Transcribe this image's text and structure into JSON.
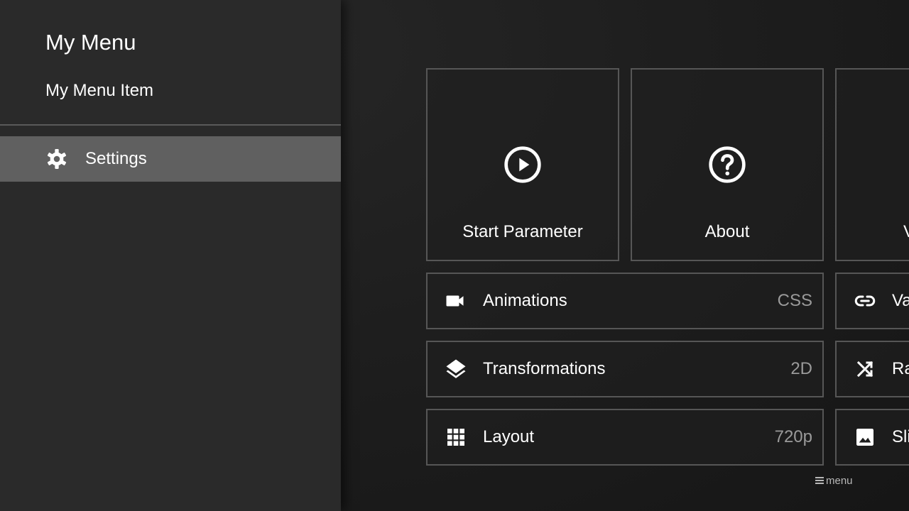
{
  "sidebar": {
    "title": "My Menu",
    "item_label": "My Menu Item",
    "settings_label": "Settings",
    "settings_icon": "gear-icon"
  },
  "tiles": {
    "start": {
      "label": "Start Parameter",
      "icon": "play-circle-icon"
    },
    "about": {
      "label": "About",
      "icon": "help-circle-icon"
    },
    "partial_top": {
      "label": "V"
    }
  },
  "rows": {
    "animations": {
      "label": "Animations",
      "value": "CSS",
      "icon": "videocam-icon"
    },
    "transformations": {
      "label": "Transformations",
      "value": "2D",
      "icon": "layers-icon"
    },
    "layout": {
      "label": "Layout",
      "value": "720p",
      "icon": "grid-icon"
    },
    "partial_1": {
      "label": "Va",
      "icon": "link-icon"
    },
    "partial_2": {
      "label": "Ra",
      "icon": "shuffle-icon"
    },
    "partial_3": {
      "label": "Sli",
      "icon": "image-icon"
    }
  },
  "hint": {
    "label": "menu",
    "icon": "hamburger-icon"
  },
  "colors": {
    "sidebar_bg": "#2a2a2a",
    "selected_bg": "#606060",
    "tile_border": "#565656",
    "value_text": "#9a9a9a"
  }
}
